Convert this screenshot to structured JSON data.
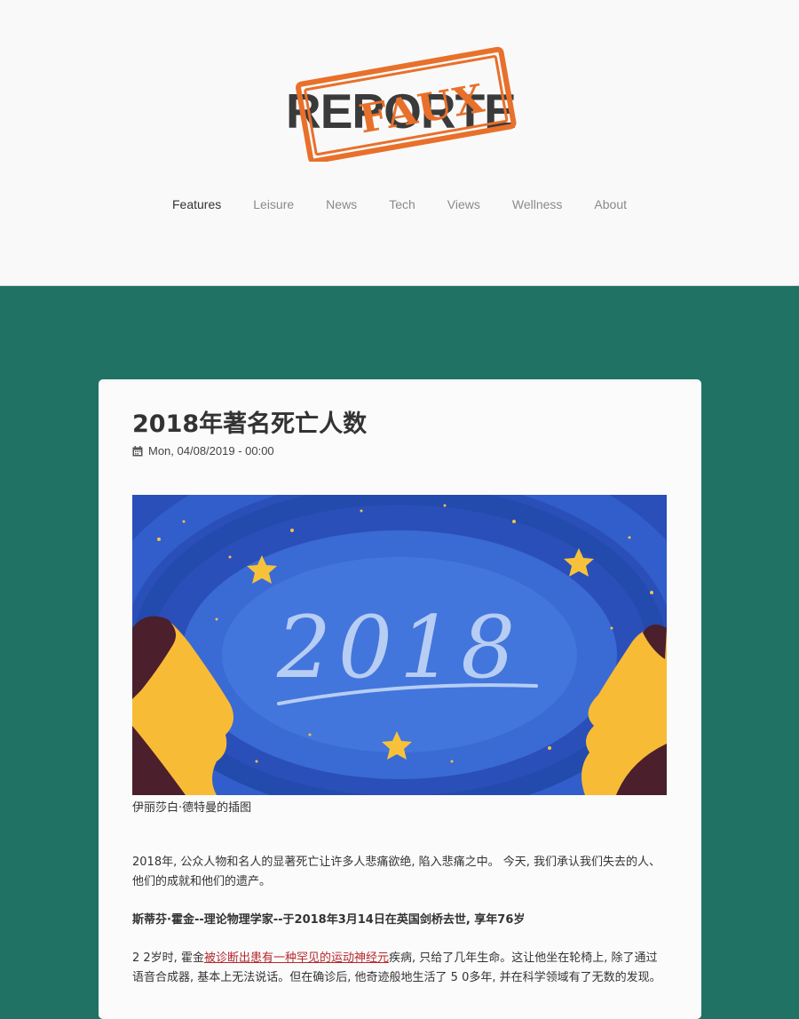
{
  "logo": {
    "main_text": "REPORTER",
    "stamp_text": "FAUX",
    "accent": "#e8702a"
  },
  "nav": {
    "items": [
      {
        "label": "Features",
        "active": true
      },
      {
        "label": "Leisure",
        "active": false
      },
      {
        "label": "News",
        "active": false
      },
      {
        "label": "Tech",
        "active": false
      },
      {
        "label": "Views",
        "active": false
      },
      {
        "label": "Wellness",
        "active": false
      },
      {
        "label": "About",
        "active": false
      }
    ]
  },
  "article": {
    "title": "2018年著名死亡人数",
    "date_icon": "calendar-icon",
    "date": "Mon, 04/08/2019 - 00:00",
    "image_text": "2018",
    "caption": "伊丽莎白·德特曼的插图",
    "paragraph1": "2018年, 公众人物和名人的显著死亡让许多人悲痛欲绝, 陷入悲痛之中。 今天, 我们承认我们失去的人、他们的成就和他们的遗产。",
    "paragraph2": "斯蒂芬·霍金--理论物理学家--于2018年3月14日在英国剑桥去世, 享年76岁",
    "paragraph3_before": "2 2岁时, 霍金",
    "paragraph3_link": "被诊断出患有一种罕见的运动神经元",
    "paragraph3_after": "疾病, 只给了几年生命。这让他坐在轮椅上, 除了通过语音合成器, 基本上无法说话。但在确诊后, 他奇迹般地生活了 5 0多年, 并在科学领域有了无数的发现。"
  },
  "colors": {
    "page_bg": "#1f7264",
    "header_bg": "#f9f9f9",
    "link": "#b5282d"
  }
}
